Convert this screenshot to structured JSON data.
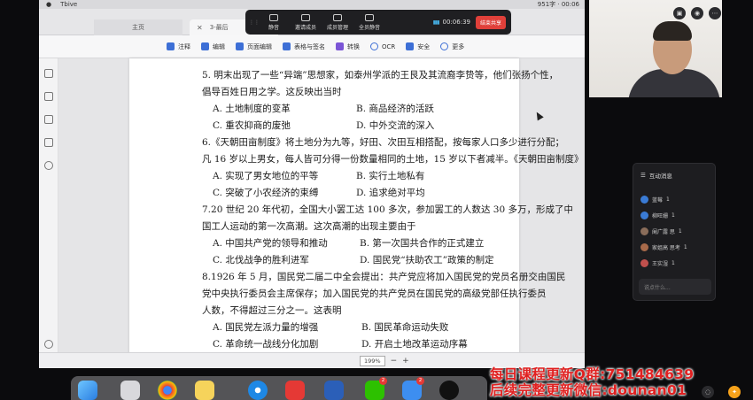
{
  "menubar": {
    "app_name": "Tbive",
    "right_text": "951字 · 00:06"
  },
  "tabs": [
    {
      "label": "主页"
    },
    {
      "label": "3-最后"
    }
  ],
  "meeting": {
    "buttons": [
      "静音",
      "邀请成员",
      "成员管理",
      "全员静音"
    ],
    "timer": "00:06:39",
    "end_share_label": "结束共享"
  },
  "toolbar": {
    "items": [
      "注释",
      "编辑",
      "页面编辑",
      "表格与签名",
      "转换",
      "OCR",
      "安全",
      "更多"
    ]
  },
  "document": {
    "lines": [
      "5. 明末出现了一些“异端”思想家，如泰州学派的王艮及其流裔李贽等，他们张扬个性，",
      "倡导百姓日用之学。这反映出当时",
      "A. 土地制度的变革",
      "B. 商品经济的活跃",
      "C. 重农抑商的废弛",
      "D. 中外交流的深入",
      "6.《天朝田亩制度》将土地分为九等，好田、次田互相搭配，按每家人口多少进行分配；",
      "凡 16 岁以上男女，每人皆可分得一份数量相同的土地，15 岁以下者减半。《天朝田亩制度》",
      "A. 实现了男女地位的平等",
      "B. 实行土地私有",
      "C. 突破了小农经济的束缚",
      "D. 追求绝对平均",
      "7.20 世纪 20 年代初，全国大小罢工达 100 多次，参加罢工的人数达 30 多万，形成了中",
      "国工人运动的第一次高潮。这次高潮的出现主要由于",
      "A. 中国共产党的领导和推动",
      "B. 第一次国共合作的正式建立",
      "C. 北伐战争的胜利进军",
      "D. 国民党“扶助农工”政策的制定",
      "8.1926 年 5 月，国民党二届二中全会提出：共产党应将加入国民党的党员名册交由国民",
      "党中央执行委员会主席保存；加入国民党的共产党员在国民党的高级党部任执行委员",
      "人数，不得超过三分之一。这表明",
      "A. 国民党左派力量的增强",
      "B. 国民革命运动失败",
      "C. 革命统一战线分化加剧",
      "D. 开启土地改革运动序幕"
    ]
  },
  "statusbar": {
    "zoom": "199%",
    "minus": "−",
    "plus": "+"
  },
  "chat": {
    "title": "互动消息",
    "rows": [
      {
        "name": "蓝莓",
        "count": "1",
        "color": "#3a7bd5"
      },
      {
        "name": "柳旺姗",
        "count": "1",
        "color": "#3a7bd5"
      },
      {
        "name": "阑广露 思",
        "count": "1",
        "color": "#8a6d5a"
      },
      {
        "name": "家姐高 思考",
        "count": "1",
        "color": "#a86a4a"
      },
      {
        "name": "王实湿",
        "count": "1",
        "color": "#c0504d"
      }
    ],
    "input_placeholder": "说点什么..."
  },
  "promo": {
    "line1": "每日课程更新Q群:751484639",
    "line2": "后续完整更新微信:dounan01"
  },
  "dock": {
    "apps": [
      "finder-icon",
      "launchpad-icon",
      "chrome-icon",
      "notes-icon",
      "safari-icon",
      "pdf-icon",
      "word-icon",
      "wechat-icon",
      "mail-icon",
      "qq-icon"
    ],
    "badges": [
      "2",
      "2"
    ]
  },
  "colors": {
    "promo_red": "#e02020",
    "end_share_red": "#e0403a",
    "accent_blue": "#3d6fd6"
  }
}
